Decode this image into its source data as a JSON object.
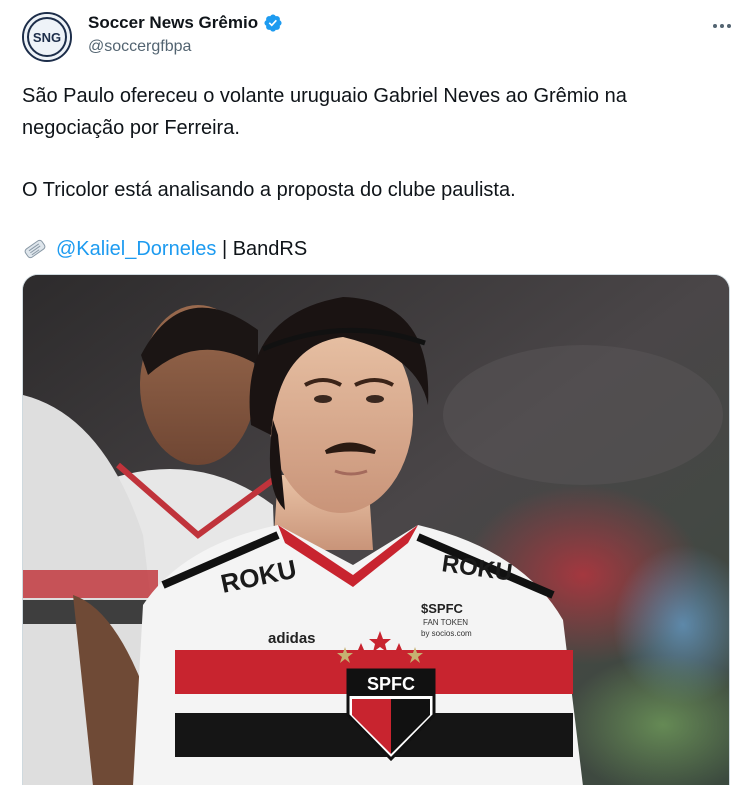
{
  "author": {
    "display_name": "Soccer News Grêmio",
    "handle": "@soccergfbpa",
    "avatar_text": "SNG",
    "verified": true
  },
  "tweet": {
    "paragraph1": "São Paulo ofereceu o volante uruguaio Gabriel Neves ao Grêmio na negociação por Ferreira.",
    "paragraph2": "O Tricolor está analisando a proposta do clube paulista.",
    "credit_icon": "newspaper-icon",
    "mention": "@Kaliel_Dorneles",
    "credit_suffix": " | BandRS"
  },
  "media": {
    "alt": "Photo of a São Paulo FC player in the white, red and black striped home shirt",
    "shirt_sponsor": "ROKU",
    "shirt_sponsor_2": "ROKU",
    "crest_text": "SPFC",
    "fan_token_brand": "$SPFC",
    "fan_token_label": "FAN TOKEN",
    "fan_token_by": "by socios.com",
    "kit_brand": "adidas"
  },
  "colors": {
    "link": "#1d9bf0",
    "verified": "#1d9bf0",
    "secondary_text": "#536471",
    "club_red": "#d3212d",
    "club_black": "#111111"
  }
}
